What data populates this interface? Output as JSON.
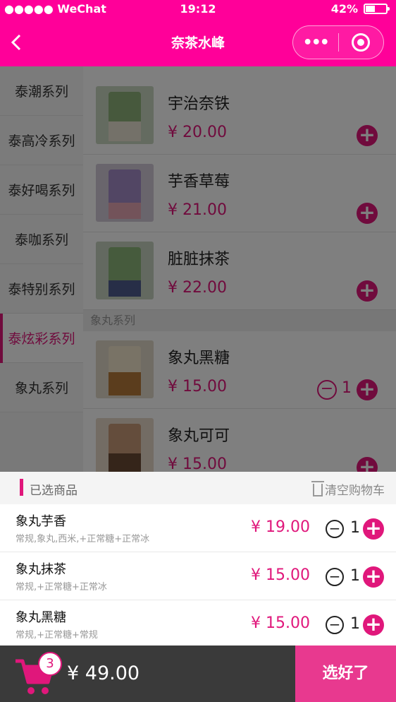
{
  "status_bar": {
    "carrier": "●●●●● WeChat",
    "time": "19:12",
    "battery": "42%"
  },
  "nav": {
    "title": "奈茶水峰"
  },
  "colors": {
    "brand": "#ff0099",
    "accent": "#e0177b",
    "checkout": "#e8398f"
  },
  "sidebar": {
    "items": [
      {
        "label": "泰潮系列"
      },
      {
        "label": "泰高冷系列"
      },
      {
        "label": "泰好喝系列"
      },
      {
        "label": "泰咖系列"
      },
      {
        "label": "泰特别系列"
      },
      {
        "label": "泰炫彩系列"
      },
      {
        "label": "象丸系列"
      }
    ]
  },
  "products": {
    "items": [
      {
        "name": "宇治奈铁",
        "price": "¥ 20.00"
      },
      {
        "name": "芋香草莓",
        "price": "¥ 21.00"
      },
      {
        "name": "脏脏抹茶",
        "price": "¥ 22.00"
      },
      {
        "name": "象丸黑糖",
        "price": "¥ 15.00",
        "qty": "1"
      },
      {
        "name": "象丸可可",
        "price": "¥ 15.00"
      }
    ],
    "section": "象丸系列"
  },
  "cart": {
    "title": "已选商品",
    "clear_label": "清空购物车",
    "items": [
      {
        "name": "象丸芋香",
        "desc": "常规,象丸,西米,+正常糖+正常冰",
        "price": "¥ 19.00",
        "qty": "1"
      },
      {
        "name": "象丸抹茶",
        "desc": "常规,+正常糖+正常冰",
        "price": "¥ 15.00",
        "qty": "1"
      },
      {
        "name": "象丸黑糖",
        "desc": "常规,+正常糖+常规",
        "price": "¥ 15.00",
        "qty": "1"
      }
    ]
  },
  "bottom": {
    "count": "3",
    "total": "¥ 49.00",
    "checkout_label": "选好了"
  },
  "icons": [
    "back-icon",
    "more-icon",
    "close-mini-icon",
    "plus-icon",
    "minus-icon",
    "trash-icon",
    "cart-icon"
  ]
}
